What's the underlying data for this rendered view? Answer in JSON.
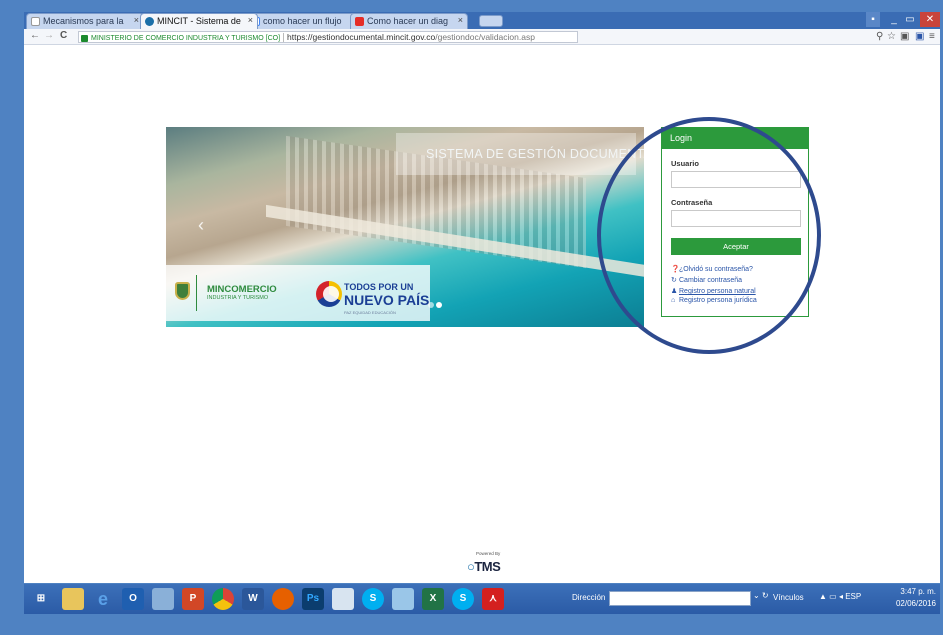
{
  "browser": {
    "tabs": [
      {
        "label": "Mecanismos para la",
        "icon": "document-icon",
        "active": false
      },
      {
        "label": "MINCIT - Sistema de",
        "icon": "mincit-icon",
        "active": true
      },
      {
        "label": "como hacer un flujo",
        "icon": "google-icon",
        "active": false
      },
      {
        "label": "Como hacer un diag",
        "icon": "youtube-icon",
        "active": false
      }
    ],
    "ssl_label": "MINISTERIO DE COMERCIO INDUSTRIA Y TURISMO [CO]",
    "url_host": "https://gestiondocumental.mincit.gov.co",
    "url_path": "/gestiondoc/validacion.asp"
  },
  "banner": {
    "title": "SISTEMA DE GESTIÓN DOCUMENTAL",
    "brand_name": "MINCOMERCIO",
    "brand_sub": "INDUSTRIA Y TURISMO",
    "slogan_line1": "TODOS POR UN",
    "slogan_line2": "NUEVO PAÍS",
    "slogan_line3": "PAZ EQUIDAD EDUCACIÓN"
  },
  "login": {
    "header": "Login",
    "user_label": "Usuario",
    "password_label": "Contraseña",
    "accept": "Aceptar",
    "links": {
      "forgot": "¿Olvidó su contraseña?",
      "change": "Cambiar contraseña",
      "natural": "Registro persona natural",
      "juridica": "Registro persona jurídica"
    }
  },
  "footer": {
    "powered_by": "Powered By",
    "brand": "TMS"
  },
  "taskbar": {
    "address_label": "Dirección",
    "links_label": "Vínculos",
    "language": "ESP",
    "time": "3:47 p. m.",
    "date": "02/06/2016"
  },
  "colors": {
    "desktop": "#4f82c2",
    "login_green": "#2c9a3c",
    "annotation_circle": "#2e4a8e"
  }
}
